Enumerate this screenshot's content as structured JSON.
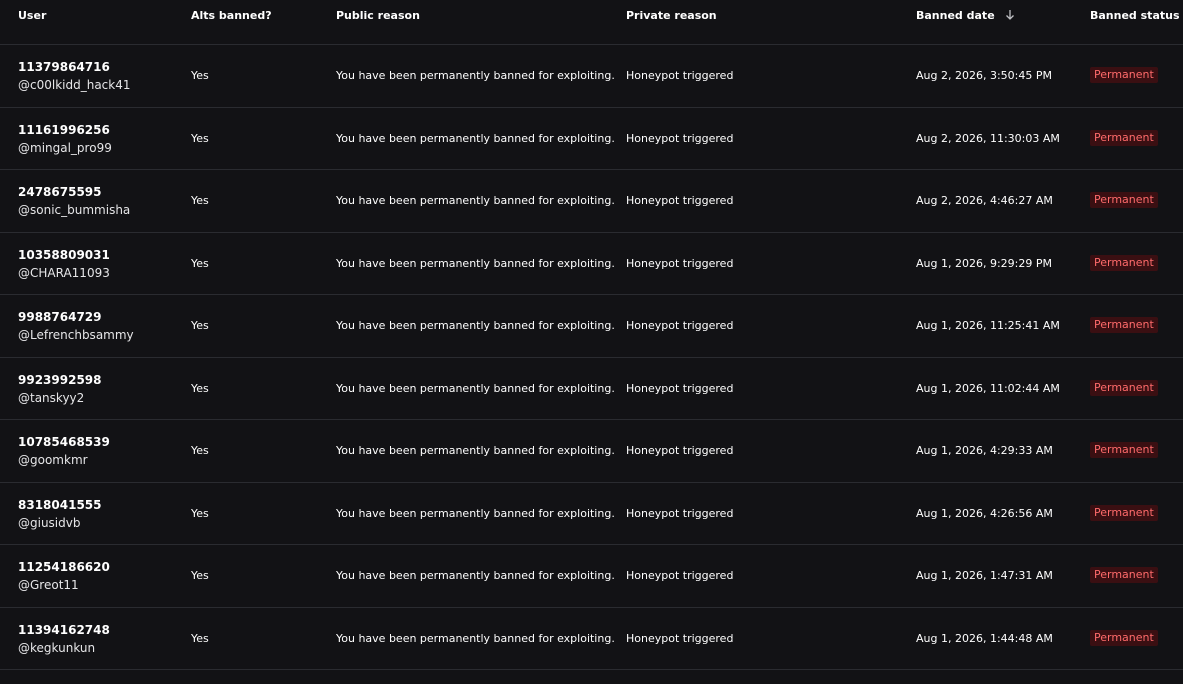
{
  "header": {
    "user": "User",
    "alts_banned": "Alts banned?",
    "public_reason": "Public reason",
    "private_reason": "Private reason",
    "banned_date": "Banned date",
    "banned_status": "Banned status"
  },
  "rows": [
    {
      "id": "11379864716",
      "handle": "@c00lkidd_hack41",
      "alts": "Yes",
      "public_reason": "You have been permanently banned for exploiting.",
      "private_reason": "Honeypot triggered",
      "date": "Aug 2, 2026, 3:50:45 PM",
      "status": "Permanent"
    },
    {
      "id": "11161996256",
      "handle": "@mingal_pro99",
      "alts": "Yes",
      "public_reason": "You have been permanently banned for exploiting.",
      "private_reason": "Honeypot triggered",
      "date": "Aug 2, 2026, 11:30:03 AM",
      "status": "Permanent"
    },
    {
      "id": "2478675595",
      "handle": "@sonic_bummisha",
      "alts": "Yes",
      "public_reason": "You have been permanently banned for exploiting.",
      "private_reason": "Honeypot triggered",
      "date": "Aug 2, 2026, 4:46:27 AM",
      "status": "Permanent"
    },
    {
      "id": "10358809031",
      "handle": "@CHARA11093",
      "alts": "Yes",
      "public_reason": "You have been permanently banned for exploiting.",
      "private_reason": "Honeypot triggered",
      "date": "Aug 1, 2026, 9:29:29 PM",
      "status": "Permanent"
    },
    {
      "id": "9988764729",
      "handle": "@Lefrenchbsammy",
      "alts": "Yes",
      "public_reason": "You have been permanently banned for exploiting.",
      "private_reason": "Honeypot triggered",
      "date": "Aug 1, 2026, 11:25:41 AM",
      "status": "Permanent"
    },
    {
      "id": "9923992598",
      "handle": "@tanskyy2",
      "alts": "Yes",
      "public_reason": "You have been permanently banned for exploiting.",
      "private_reason": "Honeypot triggered",
      "date": "Aug 1, 2026, 11:02:44 AM",
      "status": "Permanent"
    },
    {
      "id": "10785468539",
      "handle": "@goomkmr",
      "alts": "Yes",
      "public_reason": "You have been permanently banned for exploiting.",
      "private_reason": "Honeypot triggered",
      "date": "Aug 1, 2026, 4:29:33 AM",
      "status": "Permanent"
    },
    {
      "id": "8318041555",
      "handle": "@giusidvb",
      "alts": "Yes",
      "public_reason": "You have been permanently banned for exploiting.",
      "private_reason": "Honeypot triggered",
      "date": "Aug 1, 2026, 4:26:56 AM",
      "status": "Permanent"
    },
    {
      "id": "11254186620",
      "handle": "@Greot11",
      "alts": "Yes",
      "public_reason": "You have been permanently banned for exploiting.",
      "private_reason": "Honeypot triggered",
      "date": "Aug 1, 2026, 1:47:31 AM",
      "status": "Permanent"
    },
    {
      "id": "11394162748",
      "handle": "@kegkunkun",
      "alts": "Yes",
      "public_reason": "You have been permanently banned for exploiting.",
      "private_reason": "Honeypot triggered",
      "date": "Aug 1, 2026, 1:44:48 AM",
      "status": "Permanent"
    }
  ],
  "colors": {
    "background": "#121215",
    "divider": "#2a2b30",
    "badge_bg": "#3a0f12",
    "badge_text": "#ff6b6b"
  },
  "icons": {
    "sort": "arrow-down-icon"
  }
}
